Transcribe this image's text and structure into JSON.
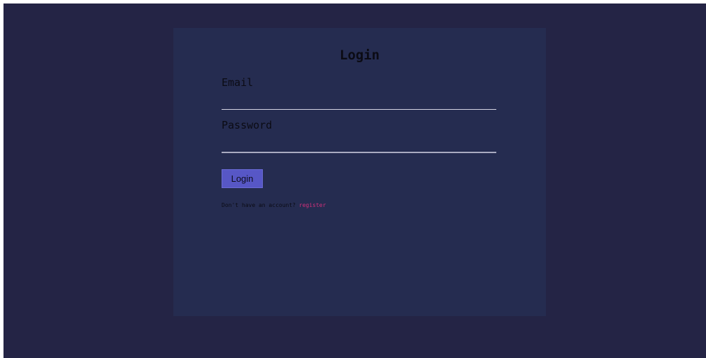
{
  "login_card": {
    "title": "Login",
    "email": {
      "label": "Email",
      "value": "",
      "placeholder": ""
    },
    "password": {
      "label": "Password",
      "value": "",
      "placeholder": ""
    },
    "submit_label": "Login",
    "register_prompt": "Don't have an account? ",
    "register_link": "register"
  },
  "colors": {
    "page_background": "#242445",
    "card_background": "#252c50",
    "button_background": "#5757c6",
    "link_color": "#d0307a",
    "text_color": "#0b0b14"
  }
}
